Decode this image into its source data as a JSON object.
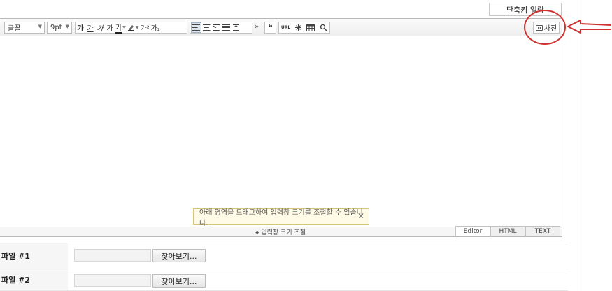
{
  "header": {
    "shortcut_button": "단축키 일람"
  },
  "toolbar": {
    "font_select": "글꼴",
    "size_select": "9pt",
    "bold": "가",
    "underline": "가",
    "italic": "가",
    "strike": "가",
    "font_color": "가",
    "superscript": "가²",
    "subscript": "가₂",
    "more": "»",
    "quote": "❝",
    "url": "URL",
    "photo_button": "사진"
  },
  "editor": {
    "resize_label": "입력창 크기 조절",
    "tooltip": "아래 영역을 드래그하여 입력창 크기를 조절할 수 있습니다.",
    "modes": [
      "Editor",
      "HTML",
      "TEXT"
    ]
  },
  "files": [
    {
      "label": "파일 #1",
      "button": "찾아보기..."
    },
    {
      "label": "파일 #2",
      "button": "찾아보기..."
    }
  ],
  "colors": {
    "annotation": "#d03030",
    "tooltip_bg": "#fffbe6",
    "toolbar_bg": "#eeeeee"
  }
}
